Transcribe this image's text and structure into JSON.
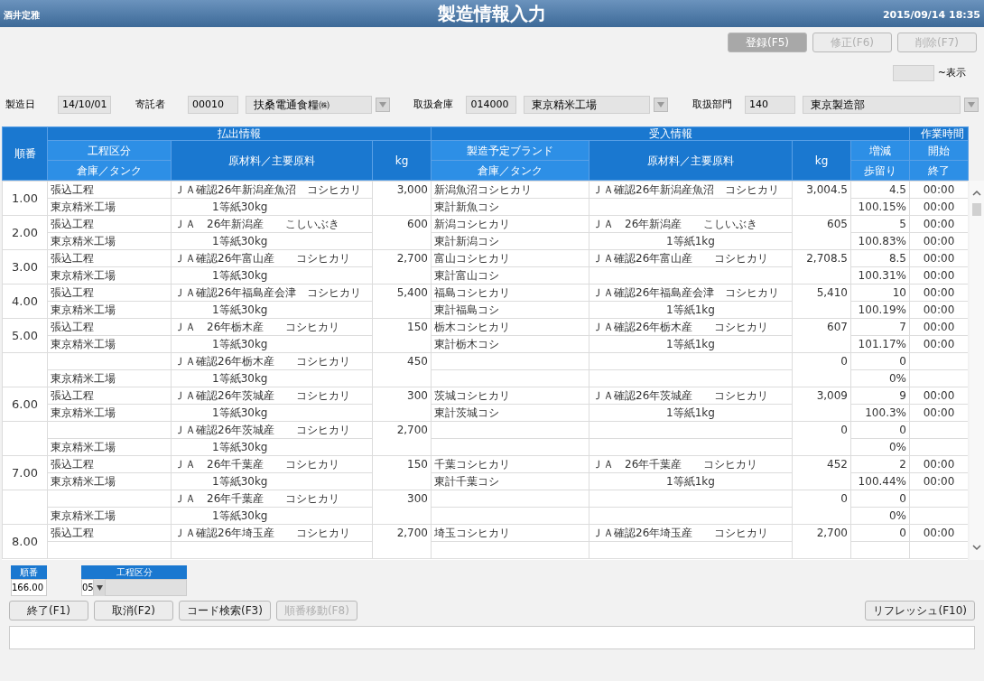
{
  "titlebar": {
    "user": "酒井定雅",
    "title": "製造情報入力",
    "datetime": "2015/09/14 18:35"
  },
  "action_buttons": [
    {
      "label": "登録(F5)",
      "disabled": true,
      "highlighted": true
    },
    {
      "label": "修正(F6)",
      "disabled": true,
      "highlighted": false
    },
    {
      "label": "削除(F7)",
      "disabled": true,
      "highlighted": false
    }
  ],
  "display_range": {
    "suffix": "~表示"
  },
  "filters": [
    {
      "kind": "date",
      "label": "製造日",
      "code": "14/10/01"
    },
    {
      "kind": "lookup",
      "label": "寄託者",
      "code": "00010",
      "name": "扶桑電通食糧㈱"
    },
    {
      "kind": "lookup",
      "label": "取扱倉庫",
      "code": "014000",
      "name": "東京精米工場"
    },
    {
      "kind": "lookup",
      "label": "取扱部門",
      "code": "140",
      "name": "東京製造部"
    }
  ],
  "header": {
    "seq": "順番",
    "out_group": "払出情報",
    "in_group": "受入情報",
    "time_group": "作業時間",
    "process": "工程区分",
    "out_tank": "倉庫／タンク",
    "out_material": "原材料／主要原料",
    "out_kg": "kg",
    "brand": "製造予定ブランド",
    "in_tank": "倉庫／タンク",
    "in_material": "原材料／主要原料",
    "in_kg": "kg",
    "diff": "増減",
    "yield": "歩留り",
    "start": "開始",
    "end": "終了"
  },
  "rows": [
    {
      "seq": "1.00",
      "process": "張込工程",
      "out_tank": "東京精米工場",
      "out_material": "ＪＡ確認26年新潟産魚沼　コシヒカリ",
      "out_material_2": "1等紙30kg",
      "out_kg": "3,000",
      "brand": "新潟魚沼コシヒカリ",
      "in_tank": "東計新魚コシ",
      "in_material": "ＪＡ確認26年新潟産魚沼　コシヒカリ",
      "in_kg": "3,004.5",
      "diff": "4.5",
      "yield": "100.15%",
      "start": "00:00",
      "end": "00:00"
    },
    {
      "seq": "2.00",
      "process": "張込工程",
      "out_tank": "東京精米工場",
      "out_material": "ＪＡ　26年新潟産　　こしいぶき",
      "out_material_2": "1等紙30kg",
      "out_kg": "600",
      "brand": "新潟コシヒカリ",
      "in_tank": "東計新潟コシ",
      "in_material": "ＪＡ　26年新潟産　　こしいぶき",
      "in_material_2": "1等紙1kg",
      "in_kg": "605",
      "diff": "5",
      "yield": "100.83%",
      "start": "00:00",
      "end": "00:00"
    },
    {
      "seq": "3.00",
      "process": "張込工程",
      "out_tank": "東京精米工場",
      "out_material": "ＪＡ確認26年富山産　　コシヒカリ",
      "out_material_2": "1等紙30kg",
      "out_kg": "2,700",
      "brand": "富山コシヒカリ",
      "in_tank": "東計富山コシ",
      "in_material": "ＪＡ確認26年富山産　　コシヒカリ",
      "in_kg": "2,708.5",
      "diff": "8.5",
      "yield": "100.31%",
      "start": "00:00",
      "end": "00:00"
    },
    {
      "seq": "4.00",
      "process": "張込工程",
      "out_tank": "東京精米工場",
      "out_material": "ＪＡ確認26年福島産会津　コシヒカリ",
      "out_material_2": "1等紙30kg",
      "out_kg": "5,400",
      "brand": "福島コシヒカリ",
      "in_tank": "東計福島コシ",
      "in_material": "ＪＡ確認26年福島産会津　コシヒカリ",
      "in_material_2": "1等紙1kg",
      "in_kg": "5,410",
      "diff": "10",
      "yield": "100.19%",
      "start": "00:00",
      "end": "00:00"
    },
    {
      "seq": "5.00",
      "process": "張込工程",
      "out_tank": "東京精米工場",
      "out_material": "ＪＡ　26年栃木産　　コシヒカリ",
      "out_material_2": "1等紙30kg",
      "out_kg": "150",
      "brand": "栃木コシヒカリ",
      "in_tank": "東計栃木コシ",
      "in_material": "ＪＡ確認26年栃木産　　コシヒカリ",
      "in_material_2": "1等紙1kg",
      "in_kg": "607",
      "diff": "7",
      "yield": "101.17%",
      "start": "00:00",
      "end": "00:00"
    },
    {
      "out_tank": "東京精米工場",
      "out_material": "ＪＡ確認26年栃木産　　コシヒカリ",
      "out_material_2": "1等紙30kg",
      "out_kg": "450",
      "in_kg": "0",
      "diff": "0",
      "yield": "0%"
    },
    {
      "seq": "6.00",
      "process": "張込工程",
      "out_tank": "東京精米工場",
      "out_material": "ＪＡ確認26年茨城産　　コシヒカリ",
      "out_material_2": "1等紙30kg",
      "out_kg": "300",
      "brand": "茨城コシヒカリ",
      "in_tank": "東計茨城コシ",
      "in_material": "ＪＡ確認26年茨城産　　コシヒカリ",
      "in_material_2": "1等紙1kg",
      "in_kg": "3,009",
      "diff": "9",
      "yield": "100.3%",
      "start": "00:00",
      "end": "00:00"
    },
    {
      "out_tank": "東京精米工場",
      "out_material": "ＪＡ確認26年茨城産　　コシヒカリ",
      "out_material_2": "1等紙30kg",
      "out_kg": "2,700",
      "in_kg": "0",
      "diff": "0",
      "yield": "0%"
    },
    {
      "seq": "7.00",
      "process": "張込工程",
      "out_tank": "東京精米工場",
      "out_material": "ＪＡ　26年千葉産　　コシヒカリ",
      "out_material_2": "1等紙30kg",
      "out_kg": "150",
      "brand": "千葉コシヒカリ",
      "in_tank": "東計千葉コシ",
      "in_material": "ＪＡ　26年千葉産　　コシヒカリ",
      "in_material_2": "1等紙1kg",
      "in_kg": "452",
      "diff": "2",
      "yield": "100.44%",
      "start": "00:00",
      "end": "00:00"
    },
    {
      "out_tank": "東京精米工場",
      "out_material": "ＪＡ　26年千葉産　　コシヒカリ",
      "out_material_2": "1等紙30kg",
      "out_kg": "300",
      "in_kg": "0",
      "diff": "0",
      "yield": "0%"
    },
    {
      "seq": "8.00",
      "process": "張込工程",
      "out_material": "ＪＡ確認26年埼玉産　　コシヒカリ",
      "out_kg": "2,700",
      "brand": "埼玉コシヒカリ",
      "in_material": "ＪＡ確認26年埼玉産　　コシヒカリ",
      "in_kg": "2,700",
      "diff": "0",
      "start": "00:00"
    }
  ],
  "entry": {
    "seq_label": "順番",
    "seq_value": "166.00",
    "process_label": "工程区分",
    "process_code": "05"
  },
  "function_buttons": [
    {
      "label": "終了(F1)",
      "disabled": false
    },
    {
      "label": "取消(F2)",
      "disabled": false
    },
    {
      "label": "コード検索(F3)",
      "disabled": false
    },
    {
      "label": "順番移動(F8)",
      "disabled": true
    }
  ],
  "refresh_buttons": [
    {
      "label": "リフレッシュ(F10)",
      "disabled": false
    }
  ]
}
